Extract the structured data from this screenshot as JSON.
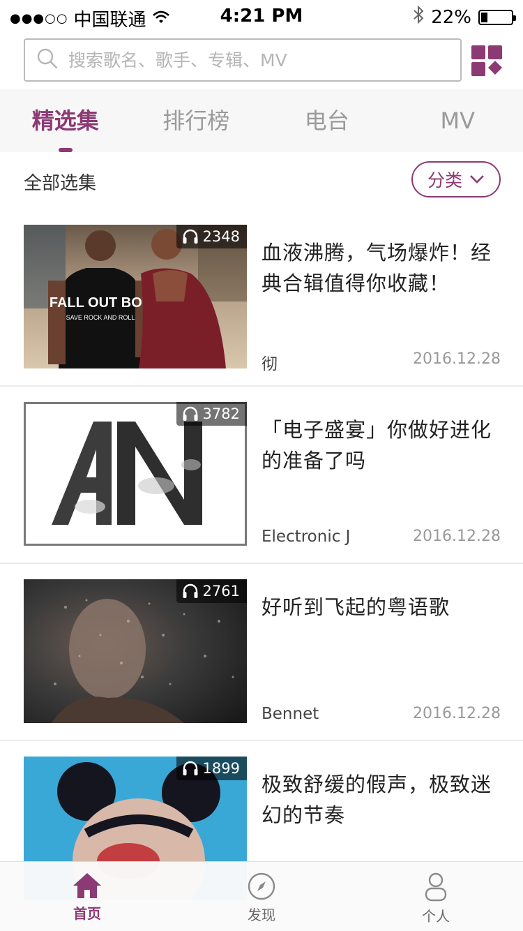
{
  "status_bar": {
    "signal": "●●●○○",
    "carrier": "中国联通",
    "time": "4:21 PM",
    "battery_text": "22%",
    "battery_level": 0.22
  },
  "search": {
    "placeholder": "搜索歌名、歌手、专辑、MV",
    "value": ""
  },
  "tabs": [
    {
      "label": "精选集",
      "active": true
    },
    {
      "label": "排行榜",
      "active": false
    },
    {
      "label": "电台",
      "active": false
    },
    {
      "label": "MV",
      "active": false
    }
  ],
  "section": {
    "title": "全部选集",
    "category_label": "分类"
  },
  "playlists": [
    {
      "plays": "2348",
      "title": "血液沸腾，气场爆炸！经典合辑值得你收藏！",
      "author": "彻",
      "date": "2016.12.28"
    },
    {
      "plays": "3782",
      "title": "「电子盛宴」你做好进化的准备了吗",
      "author": "Electronic J",
      "date": "2016.12.28"
    },
    {
      "plays": "2761",
      "title": "好听到飞起的粤语歌",
      "author": "Bennet",
      "date": "2016.12.28"
    },
    {
      "plays": "1899",
      "title": "极致舒缓的假声，极致迷幻的节奏",
      "author": "",
      "date": ""
    }
  ],
  "covers": {
    "c1_shirt_text": "FALL OUT BOY",
    "c1_shirt_sub": "SAVE ROCK AND ROLL"
  },
  "tabbar": [
    {
      "label": "首页",
      "icon": "home-icon",
      "active": true
    },
    {
      "label": "发现",
      "icon": "compass-icon",
      "active": false
    },
    {
      "label": "个人",
      "icon": "person-icon",
      "active": false
    }
  ],
  "colors": {
    "accent": "#8c3a74",
    "inactive": "#9a9a9a"
  }
}
